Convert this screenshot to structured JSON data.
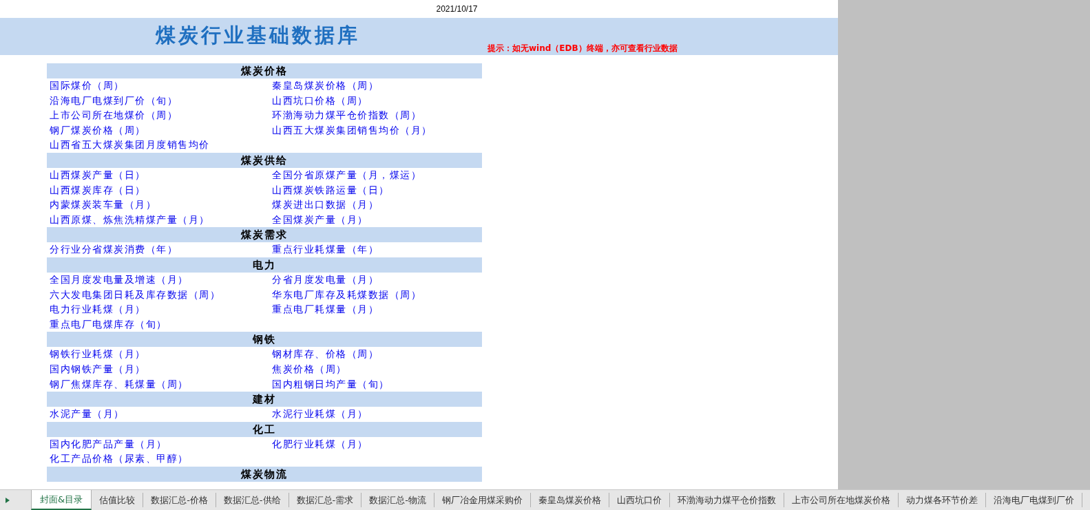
{
  "date": "2021/10/17",
  "title": "煤炭行业基础数据库",
  "hint": "提示：如无wind（EDB）终端，亦可查看行业数据",
  "sections": [
    {
      "title": "煤炭价格",
      "items": [
        "国际煤价（周）",
        "秦皇岛煤炭价格（周）",
        "沿海电厂电煤到厂价（旬）",
        "山西坑口价格（周）",
        "上市公司所在地煤价（周）",
        "环渤海动力煤平仓价指数（周）",
        "钢厂煤炭价格（周）",
        "山西五大煤炭集团销售均价（月）",
        "山西省五大煤炭集团月度销售均价"
      ]
    },
    {
      "title": "煤炭供给",
      "items": [
        "山西煤炭产量（日）",
        "全国分省原煤产量（月，煤运）",
        "山西煤炭库存（日）",
        "山西煤炭铁路运量（日）",
        "内蒙煤炭装车量（月）",
        "煤炭进出口数据（月）",
        "山西原煤、炼焦洗精煤产量（月）",
        "全国煤炭产量（月）"
      ]
    },
    {
      "title": "煤炭需求",
      "items": [
        "分行业分省煤炭消费（年）",
        "重点行业耗煤量（年）"
      ]
    },
    {
      "title": "电力",
      "items": [
        "全国月度发电量及增速（月）",
        "分省月度发电量（月）",
        "六大发电集团日耗及库存数据（周）",
        "华东电厂库存及耗煤数据（周）",
        "电力行业耗煤（月）",
        "重点电厂耗煤量（月）",
        "重点电厂电煤库存（旬）"
      ]
    },
    {
      "title": "钢铁",
      "items": [
        "钢铁行业耗煤（月）",
        "钢材库存、价格（周）",
        "国内钢铁产量（月）",
        "焦炭价格（周）",
        "钢厂焦煤库存、耗煤量（周）",
        "国内粗钢日均产量（旬）"
      ]
    },
    {
      "title": "建材",
      "items": [
        "水泥产量（月）",
        "水泥行业耗煤（月）"
      ]
    },
    {
      "title": "化工",
      "items": [
        "国内化肥产品产量（月）",
        "化肥行业耗煤（月）",
        "化工产品价格（尿素、甲醇）"
      ]
    },
    {
      "title": "煤炭物流"
    }
  ],
  "sheet_tabs": [
    {
      "label": "封面&目录",
      "selected": true
    },
    {
      "label": "估值比较",
      "selected": false
    },
    {
      "label": "数据汇总-价格",
      "selected": false
    },
    {
      "label": "数据汇总-供给",
      "selected": false
    },
    {
      "label": "数据汇总-需求",
      "selected": false
    },
    {
      "label": "数据汇总-物流",
      "selected": false
    },
    {
      "label": "钢厂冶金用煤采购价",
      "selected": false
    },
    {
      "label": "秦皇岛煤炭价格",
      "selected": false
    },
    {
      "label": "山西坑口价",
      "selected": false
    },
    {
      "label": "环渤海动力煤平仓价指数",
      "selected": false
    },
    {
      "label": "上市公司所在地煤炭价格",
      "selected": false
    },
    {
      "label": "动力煤各环节价差",
      "selected": false
    },
    {
      "label": "沿海电厂电煤到厂价",
      "selected": false
    }
  ]
}
